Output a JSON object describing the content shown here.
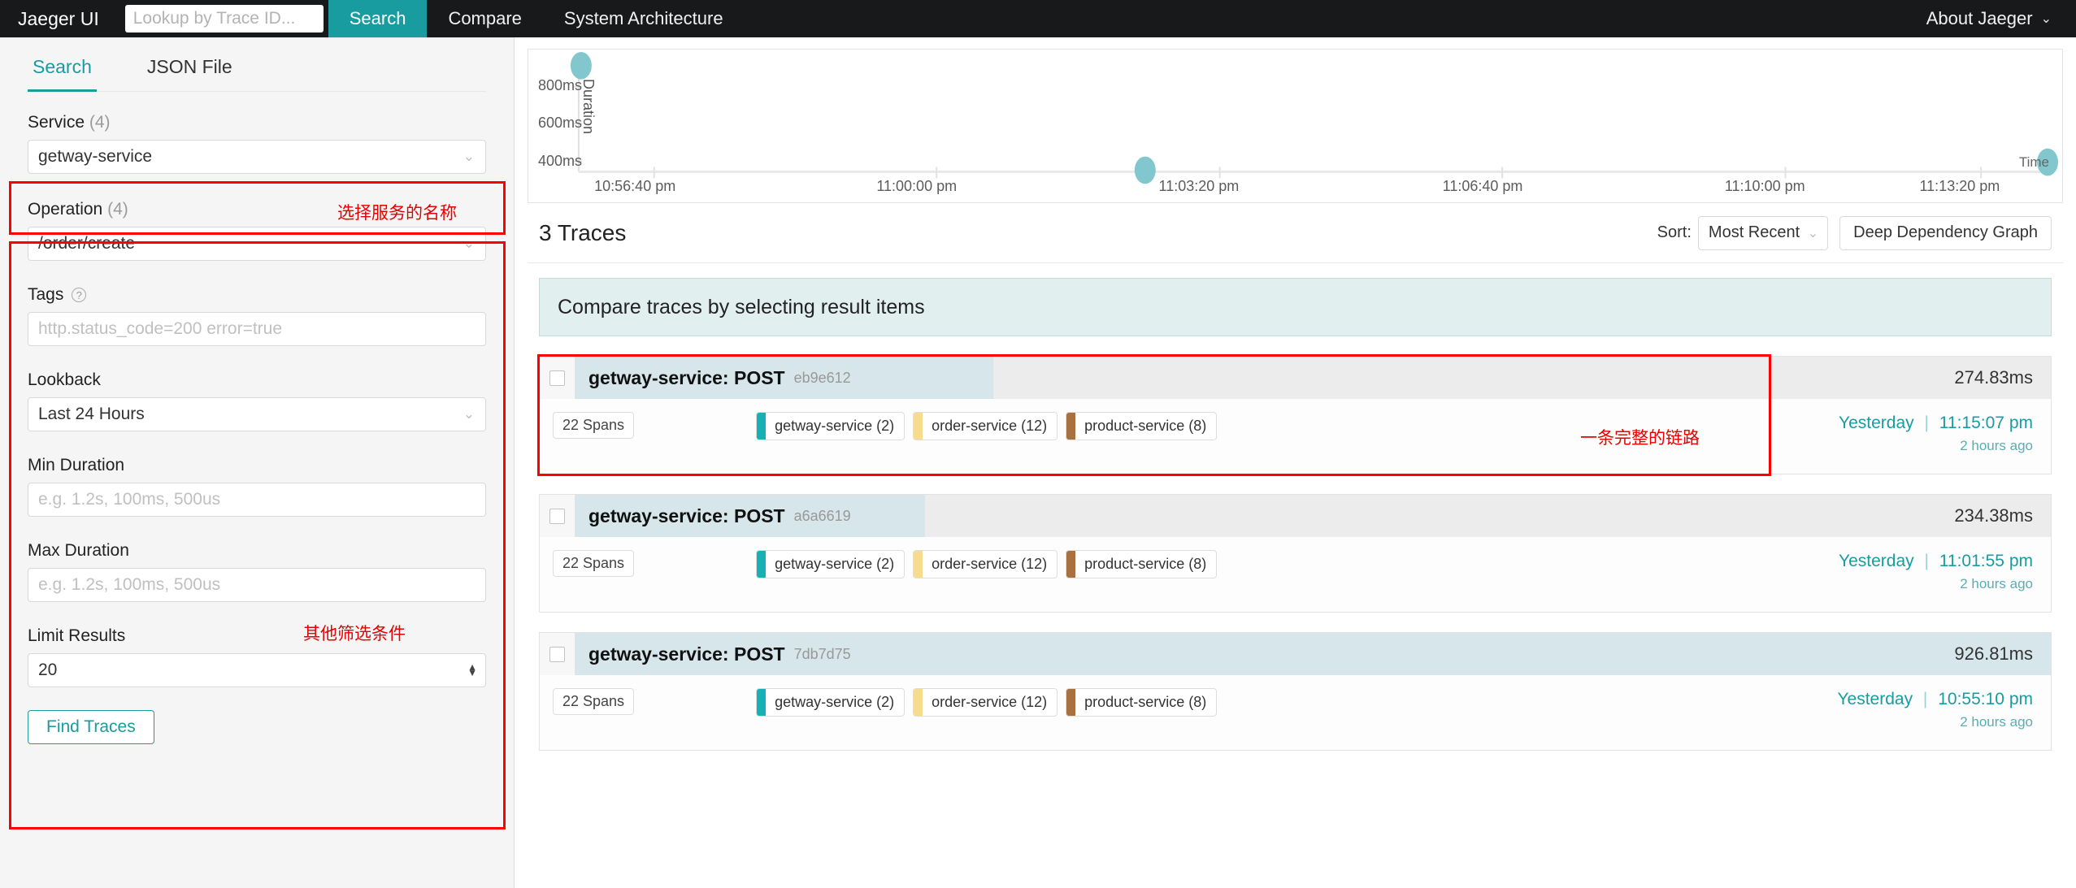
{
  "nav": {
    "brand": "Jaeger UI",
    "traceid_placeholder": "Lookup by Trace ID...",
    "items": [
      {
        "label": "Search",
        "active": true
      },
      {
        "label": "Compare",
        "active": false
      },
      {
        "label": "System Architecture",
        "active": false
      }
    ],
    "about": "About Jaeger",
    "about_caret": "⌄"
  },
  "sidebar": {
    "tabs": [
      {
        "label": "Search",
        "active": true
      },
      {
        "label": "JSON File",
        "active": false
      }
    ],
    "service": {
      "label": "Service",
      "count": "(4)",
      "value": "getway-service",
      "annotation": "选择服务的名称"
    },
    "operation": {
      "label": "Operation",
      "count": "(4)",
      "value": "/order/create"
    },
    "tags": {
      "label": "Tags",
      "help_icon": "question-mark-icon",
      "placeholder": "http.status_code=200 error=true",
      "value": ""
    },
    "lookback": {
      "label": "Lookback",
      "value": "Last 24 Hours"
    },
    "min_duration": {
      "label": "Min Duration",
      "placeholder": "e.g. 1.2s, 100ms, 500us",
      "value": "",
      "annotation": "其他筛选条件"
    },
    "max_duration": {
      "label": "Max Duration",
      "placeholder": "e.g. 1.2s, 100ms, 500us",
      "value": ""
    },
    "limit_results": {
      "label": "Limit Results",
      "value": "20"
    },
    "find_button": "Find Traces"
  },
  "results": {
    "count_label": "3 Traces",
    "sort_label": "Sort:",
    "sort_value": "Most Recent",
    "ddg_button": "Deep Dependency Graph",
    "compare_banner": "Compare traces by selecting result items",
    "row_annotation": "一条完整的链路"
  },
  "chart_data": {
    "type": "scatter",
    "title": "",
    "xlabel": "Time",
    "ylabel": "Duration",
    "x_ticks": [
      "10:56:40 pm",
      "11:00:00 pm",
      "11:03:20 pm",
      "11:06:40 pm",
      "11:10:00 pm",
      "11:13:20 pm"
    ],
    "y_ticks": [
      "400ms",
      "600ms",
      "800ms"
    ],
    "ylim": [
      0,
      1000
    ],
    "grid": false,
    "legend": "none",
    "point_color": "#81c7cd",
    "points": [
      {
        "time": "10:55:10 pm",
        "duration_ms": 926.81,
        "x_frac": 0.012,
        "y_frac": 0.927
      },
      {
        "time": "11:01:55 pm",
        "duration_ms": 234.38,
        "x_frac": 0.396,
        "y_frac": 0.234
      },
      {
        "time": "11:15:07 pm",
        "duration_ms": 274.83,
        "x_frac": 0.993,
        "y_frac": 0.275
      }
    ]
  },
  "traces": [
    {
      "title": "getway-service: POST",
      "trace_id": "eb9e612",
      "duration": "274.83ms",
      "bar_frac": 0.3,
      "spans": "22 Spans",
      "services": [
        {
          "name": "getway-service (2)",
          "color": "#17b0b4"
        },
        {
          "name": "order-service (12)",
          "color": "#f7db8e"
        },
        {
          "name": "product-service (8)",
          "color": "#a9713f"
        }
      ],
      "day": "Yesterday",
      "time": "11:15:07 pm",
      "ago": "2 hours ago"
    },
    {
      "title": "getway-service: POST",
      "trace_id": "a6a6619",
      "duration": "234.38ms",
      "bar_frac": 0.255,
      "spans": "22 Spans",
      "services": [
        {
          "name": "getway-service (2)",
          "color": "#17b0b4"
        },
        {
          "name": "order-service (12)",
          "color": "#f7db8e"
        },
        {
          "name": "product-service (8)",
          "color": "#a9713f"
        }
      ],
      "day": "Yesterday",
      "time": "11:01:55 pm",
      "ago": "2 hours ago"
    },
    {
      "title": "getway-service: POST",
      "trace_id": "7db7d75",
      "duration": "926.81ms",
      "bar_frac": 1.0,
      "spans": "22 Spans",
      "services": [
        {
          "name": "getway-service (2)",
          "color": "#17b0b4"
        },
        {
          "name": "order-service (12)",
          "color": "#f7db8e"
        },
        {
          "name": "product-service (8)",
          "color": "#a9713f"
        }
      ],
      "day": "Yesterday",
      "time": "10:55:10 pm",
      "ago": "2 hours ago"
    }
  ],
  "colors": {
    "accent": "#199ca0",
    "nav_bg": "#17191a",
    "annotation_red": "#e60000",
    "trace_bar": "#d6e6ea"
  }
}
